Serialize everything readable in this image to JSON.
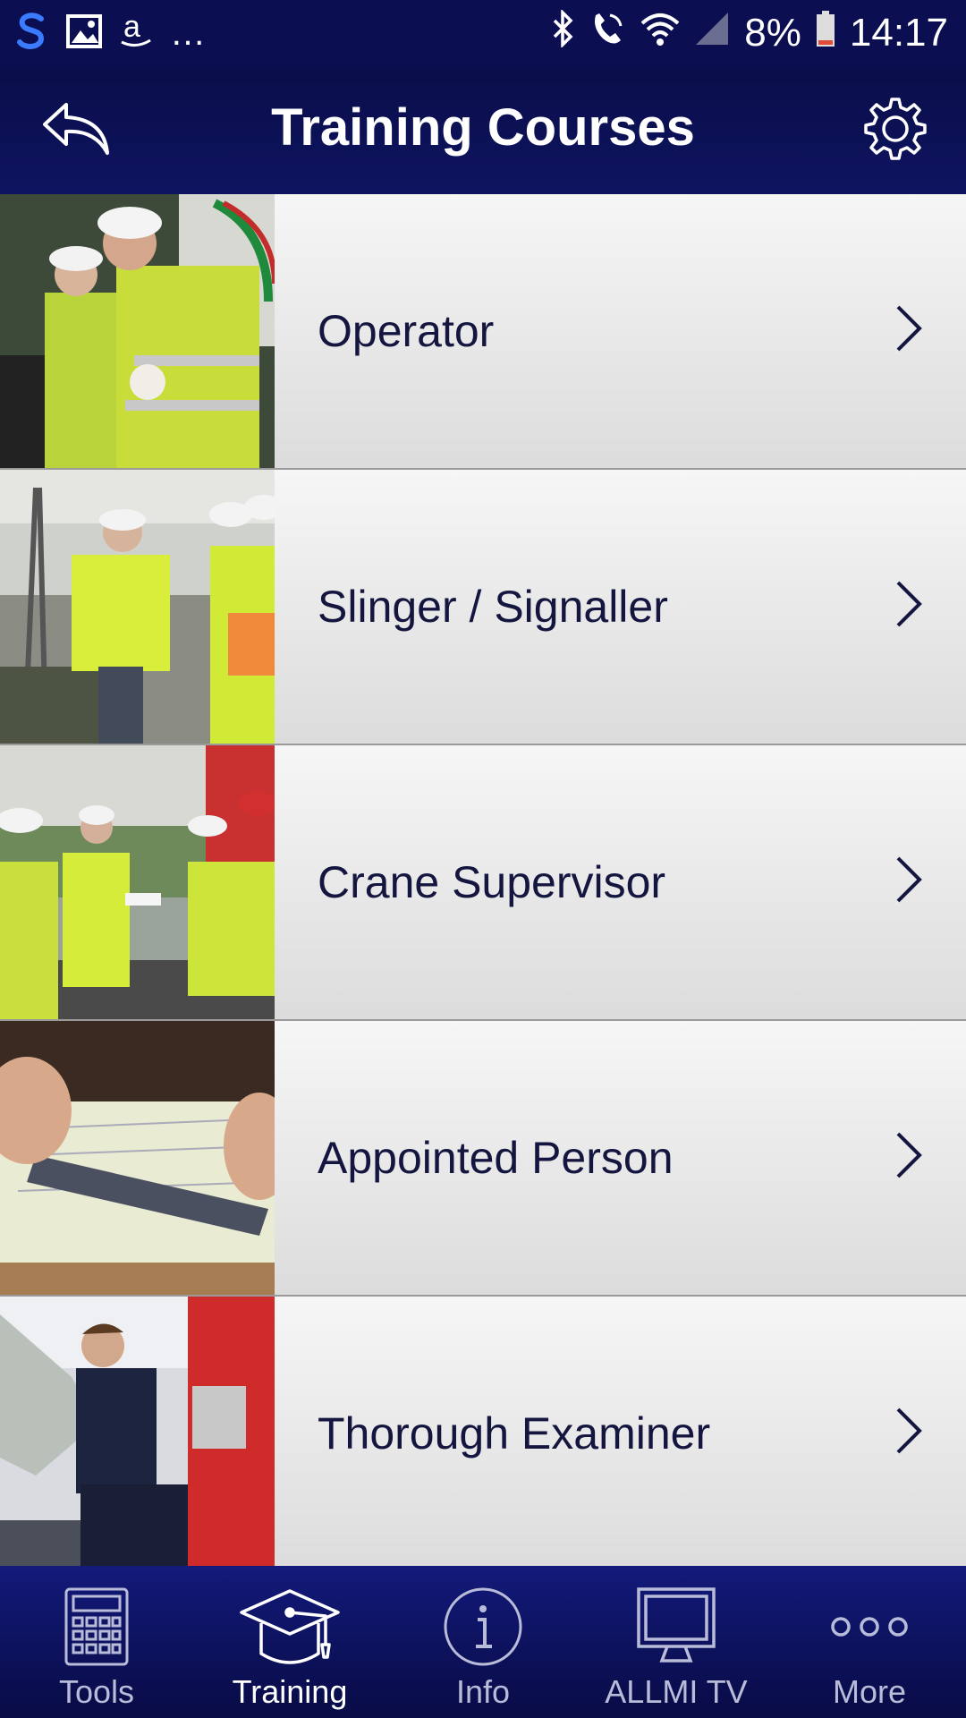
{
  "status_bar": {
    "battery": "8%",
    "time": "14:17"
  },
  "header": {
    "title": "Training Courses"
  },
  "courses": [
    {
      "label": "Operator"
    },
    {
      "label": "Slinger / Signaller"
    },
    {
      "label": "Crane Supervisor"
    },
    {
      "label": "Appointed Person"
    },
    {
      "label": "Thorough Examiner"
    }
  ],
  "tabbar": {
    "tabs": [
      {
        "label": "Tools",
        "icon": "calculator-icon"
      },
      {
        "label": "Training",
        "icon": "graduation-cap-icon",
        "active": true
      },
      {
        "label": "Info",
        "icon": "info-icon"
      },
      {
        "label": "ALLMI TV",
        "icon": "monitor-icon"
      },
      {
        "label": "More",
        "icon": "more-dots-icon"
      }
    ]
  },
  "colors": {
    "header_bg": "#0b0f52",
    "row_text": "#14163f",
    "active_tab": "#ffffff",
    "inactive_tab": "#b9bcd9"
  }
}
